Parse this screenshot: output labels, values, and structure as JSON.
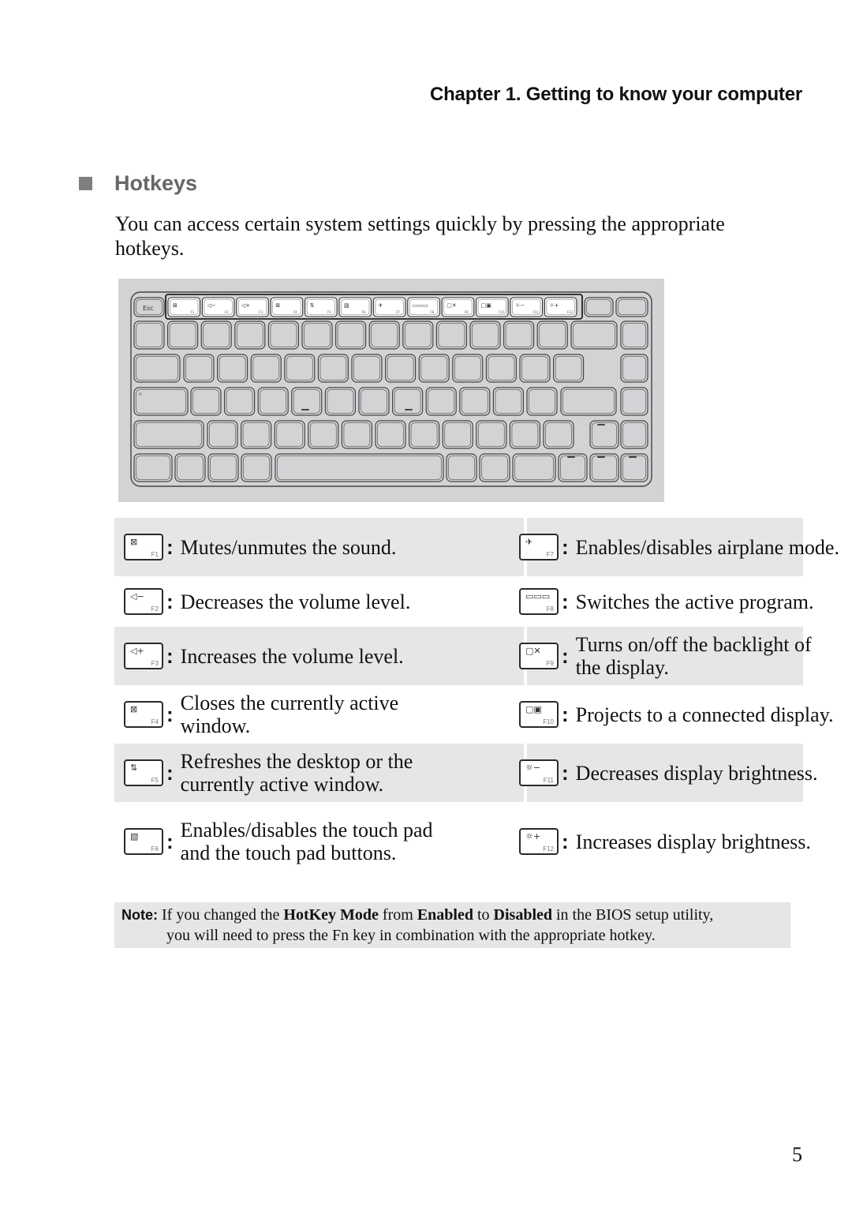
{
  "header": {
    "chapter": "Chapter 1. Getting to know your computer"
  },
  "section": {
    "title": "Hotkeys",
    "bullet_color": "#7f7f7f"
  },
  "intro": "You can access certain system settings quickly by pressing the appropriate hotkeys.",
  "keyboard": {
    "esc_label": "Esc",
    "fkeys": [
      {
        "fn": "F1",
        "icon": "mute-icon",
        "glyph": "⊠"
      },
      {
        "fn": "F2",
        "icon": "volume-down-icon",
        "glyph": "◁−"
      },
      {
        "fn": "F3",
        "icon": "volume-up-icon",
        "glyph": "◁+"
      },
      {
        "fn": "F4",
        "icon": "close-window-icon",
        "glyph": "⊠"
      },
      {
        "fn": "F5",
        "icon": "refresh-icon",
        "glyph": "⇅"
      },
      {
        "fn": "F6",
        "icon": "touchpad-toggle-icon",
        "glyph": "▧"
      },
      {
        "fn": "F7",
        "icon": "airplane-icon",
        "glyph": "✈"
      },
      {
        "fn": "F8",
        "icon": "switch-program-icon",
        "glyph": "▭▭▭"
      },
      {
        "fn": "F9",
        "icon": "backlight-icon",
        "glyph": "▢✕"
      },
      {
        "fn": "F10",
        "icon": "project-display-icon",
        "glyph": "▢▣"
      },
      {
        "fn": "F11",
        "icon": "brightness-down-icon",
        "glyph": "☼−"
      },
      {
        "fn": "F12",
        "icon": "brightness-up-icon",
        "glyph": "☼+"
      }
    ]
  },
  "hotkeys": [
    {
      "left": {
        "fn": "F1",
        "icon": "mute-icon",
        "glyph": "⊠",
        "desc": "Mutes/unmutes the sound."
      },
      "right": {
        "fn": "F7",
        "icon": "airplane-icon",
        "glyph": "✈",
        "desc": "Enables/disables airplane mode."
      }
    },
    {
      "left": {
        "fn": "F2",
        "icon": "volume-down-icon",
        "glyph": "◁−",
        "desc": "Decreases the volume level."
      },
      "right": {
        "fn": "F8",
        "icon": "switch-program-icon",
        "glyph": "▭▭▭",
        "desc": "Switches the active program."
      }
    },
    {
      "left": {
        "fn": "F3",
        "icon": "volume-up-icon",
        "glyph": "◁+",
        "desc": "Increases the volume level."
      },
      "right": {
        "fn": "F9",
        "icon": "backlight-icon",
        "glyph": "▢✕",
        "desc": "Turns on/off the backlight of the display."
      }
    },
    {
      "left": {
        "fn": "F4",
        "icon": "close-window-icon",
        "glyph": "⊠",
        "desc": "Closes the currently active window."
      },
      "right": {
        "fn": "F10",
        "icon": "project-display-icon",
        "glyph": "▢▣",
        "desc": "Projects to a connected display."
      }
    },
    {
      "left": {
        "fn": "F5",
        "icon": "refresh-icon",
        "glyph": "⇅",
        "desc": "Refreshes the desktop or the currently active window."
      },
      "right": {
        "fn": "F11",
        "icon": "brightness-down-icon",
        "glyph": "☼−",
        "desc": "Decreases display brightness."
      }
    },
    {
      "left": {
        "fn": "F6",
        "icon": "touchpad-toggle-icon",
        "glyph": "▧",
        "desc": "Enables/disables the touch pad and the touch pad buttons."
      },
      "right": {
        "fn": "F12",
        "icon": "brightness-up-icon",
        "glyph": "☼+",
        "desc": "Increases display brightness."
      }
    }
  ],
  "note": {
    "label": "Note:",
    "t1": " If you changed the ",
    "b1": "HotKey Mode",
    "t2": " from ",
    "b2": "Enabled",
    "t3": " to ",
    "b3": "Disabled",
    "t4": " in the BIOS setup utility,",
    "line2": "you will need to press the Fn key in combination with the appropriate hotkey."
  },
  "page_number": "5"
}
